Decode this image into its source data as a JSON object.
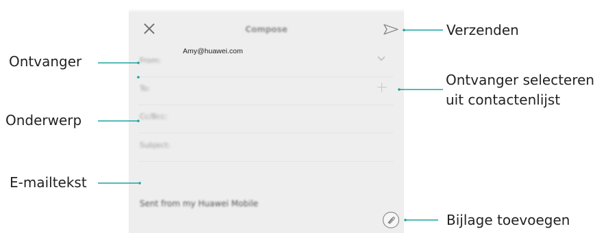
{
  "screen": {
    "title": "Compose",
    "from_label": "From:",
    "from_value": "Amy@huawei.com",
    "to_label": "To:",
    "cc_label": "Cc/Bcc:",
    "subject_label": "Subject:",
    "signature": "Sent from my Huawei Mobile",
    "icons": {
      "close": "close-icon",
      "send": "send-icon",
      "expand": "chevron-down-icon",
      "add_recipient": "plus-icon",
      "attach": "paperclip-icon"
    }
  },
  "callouts": {
    "recipient": "Ontvanger",
    "subject": "Onderwerp",
    "body": "E-mailtekst",
    "send": "Verzenden",
    "select_line1": "Ontvanger selecteren",
    "select_line2": "uit contactenlijst",
    "attach": "Bijlage toevoegen"
  },
  "colors": {
    "callout_line": "#19a3a0",
    "screen_bg": "#eeeeee"
  }
}
